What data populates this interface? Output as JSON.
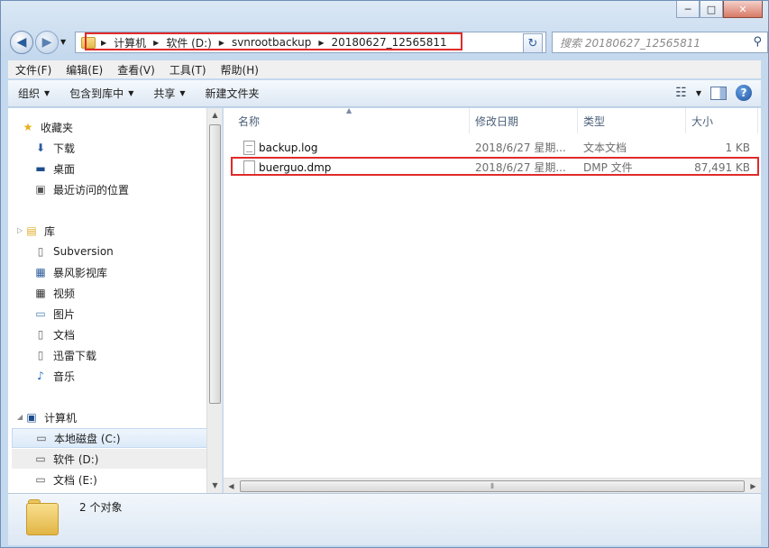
{
  "window_controls": {
    "minimize": "─",
    "maximize": "□",
    "close": "✕"
  },
  "address": {
    "crumbs": [
      "计算机",
      "软件 (D:)",
      "svnrootbackup",
      "20180627_12565811"
    ]
  },
  "search": {
    "placeholder": "搜索 20180627_12565811"
  },
  "menu": [
    "文件(F)",
    "编辑(E)",
    "查看(V)",
    "工具(T)",
    "帮助(H)"
  ],
  "toolbar": {
    "organize": "组织",
    "include": "包含到库中",
    "share": "共享",
    "new_folder": "新建文件夹"
  },
  "nav": {
    "favorites": {
      "label": "收藏夹",
      "items": [
        "下载",
        "桌面",
        "最近访问的位置"
      ]
    },
    "library": {
      "label": "库",
      "items": [
        "Subversion",
        "暴风影视库",
        "视频",
        "图片",
        "文档",
        "迅雷下载",
        "音乐"
      ]
    },
    "computer": {
      "label": "计算机",
      "items": [
        "本地磁盘 (C:)",
        "软件 (D:)",
        "文档 (E:)"
      ]
    }
  },
  "columns": {
    "name": "名称",
    "date": "修改日期",
    "type": "类型",
    "size": "大小"
  },
  "files": [
    {
      "name": "backup.log",
      "date": "2018/6/27 星期...",
      "type": "文本文档",
      "size": "1 KB"
    },
    {
      "name": "buerguo.dmp",
      "date": "2018/6/27 星期...",
      "type": "DMP 文件",
      "size": "87,491 KB"
    }
  ],
  "status": {
    "count": "2 个对象"
  },
  "colors": {
    "highlight": "#e12a2a",
    "accent": "#2b5c9a"
  }
}
